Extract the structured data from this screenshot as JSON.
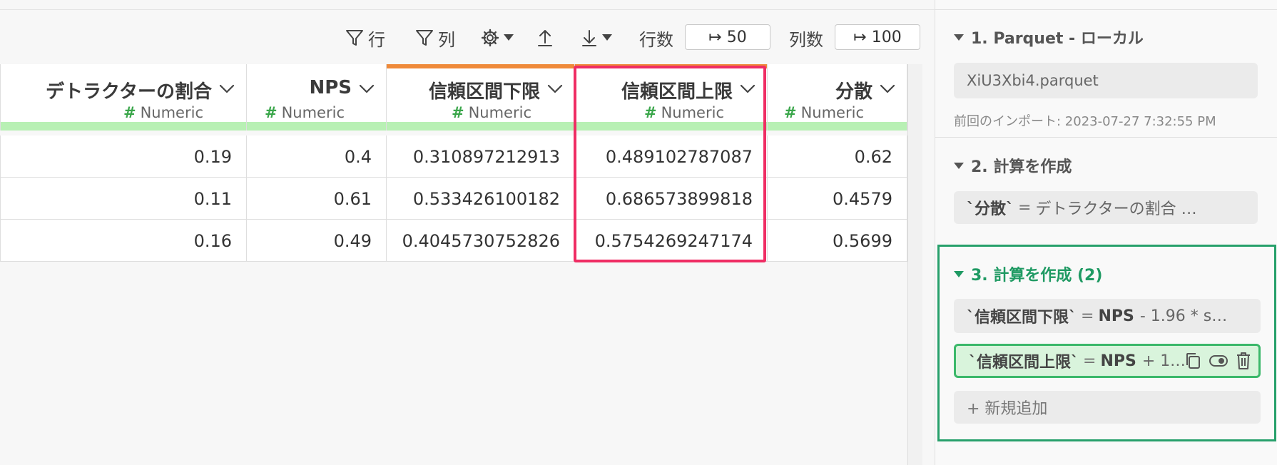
{
  "toolbar": {
    "row_filter_label": "行",
    "col_filter_label": "列",
    "row_count_label": "行数",
    "row_count_value": "↦ 50",
    "col_count_label": "列数",
    "col_count_value": "↦ 100"
  },
  "table": {
    "columns": [
      {
        "name": "デトラクターの割合",
        "type": "Numeric"
      },
      {
        "name": "NPS",
        "type": "Numeric"
      },
      {
        "name": "信頼区間下限",
        "type": "Numeric"
      },
      {
        "name": "信頼区間上限",
        "type": "Numeric"
      },
      {
        "name": "分散",
        "type": "Numeric"
      }
    ],
    "type_hash": "#",
    "rows": [
      [
        "0.19",
        "0.4",
        "0.310897212913",
        "0.489102787087",
        "0.62"
      ],
      [
        "0.11",
        "0.61",
        "0.533426100182",
        "0.686573899818",
        "0.4579"
      ],
      [
        "0.16",
        "0.49",
        "0.4045730752826",
        "0.5754269247174",
        "0.5699"
      ]
    ]
  },
  "panel": {
    "step1": {
      "title": "1. Parquet - ローカル",
      "file": "XiU3Xbi4.parquet",
      "last_import": "前回のインポート: 2023-07-27 7:32:55 PM"
    },
    "step2": {
      "title": "2. 計算を作成",
      "expr_name": "`分散`",
      "expr_eq": "=",
      "expr_rest": "デトラクターの割合 …"
    },
    "step3": {
      "title": "3. 計算を作成 (2)",
      "expr1_name": "`信頼区間下限`",
      "expr1_eq": "=",
      "expr1_col": "NPS",
      "expr1_rest": "- 1.96 * s…",
      "expr2_name": "`信頼区間上限`",
      "expr2_eq": "=",
      "expr2_col": "NPS",
      "expr2_rest": "+ 1.…",
      "add_new": "+ 新規追加"
    }
  },
  "colors": {
    "accent_green": "#27a06b",
    "highlight_pink": "#ef2d64",
    "quality_bar": "#b8f0b4",
    "orange_bar": "#ef8a3a"
  }
}
